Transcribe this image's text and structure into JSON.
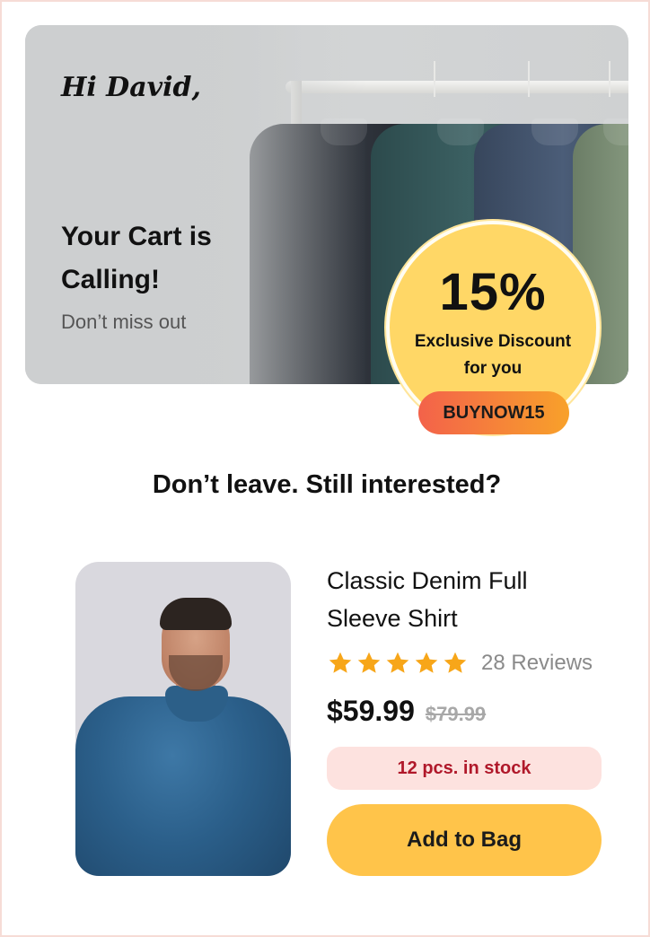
{
  "hero": {
    "greeting": "Hi David,",
    "title": "Your Cart is Calling!",
    "subtitle": "Don’t miss out"
  },
  "offer": {
    "percent": "15%",
    "line1": "Exclusive Discount",
    "line2": "for you",
    "code": "BUYNOW15"
  },
  "headline": "Don’t leave. Still interested?",
  "product": {
    "name": "Classic Denim Full Sleeve Shirt",
    "rating": 5,
    "reviews": "28 Reviews",
    "price": "$59.99",
    "old_price": "$79.99",
    "stock": "12 pcs. in stock",
    "cta": "Add to Bag",
    "image_icon": "product-photo-man-denim-shirt"
  },
  "colors": {
    "badge": "#ffd766",
    "button": "#ffc44a",
    "stock_text": "#b0182a",
    "stock_bg": "#fde2df",
    "star": "#f7a619"
  }
}
